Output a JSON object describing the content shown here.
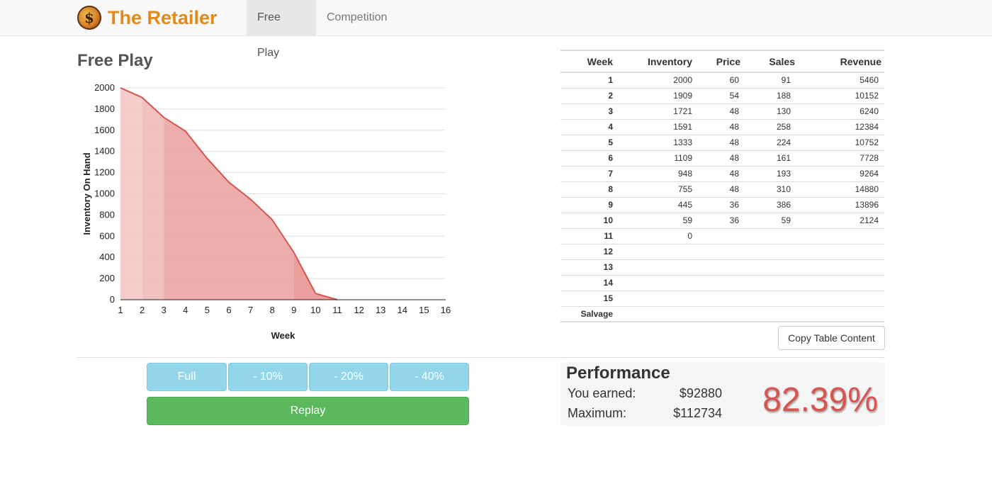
{
  "nav": {
    "brand_title": "The Retailer",
    "brand_glyph": "$",
    "tabs": [
      {
        "label": "Free Play",
        "active": true
      },
      {
        "label": "Competition",
        "active": false
      }
    ]
  },
  "page_title": "Free Play",
  "chart_data": {
    "type": "area",
    "xlabel": "Week",
    "ylabel": "Inventory On Hand",
    "x_ticks": [
      "1",
      "2",
      "3",
      "4",
      "5",
      "6",
      "7",
      "8",
      "9",
      "10",
      "11",
      "12",
      "13",
      "14",
      "15",
      "16"
    ],
    "y_ticks": [
      "0",
      "200",
      "400",
      "600",
      "800",
      "1000",
      "1200",
      "1400",
      "1600",
      "1800",
      "2000"
    ],
    "xlim": [
      1,
      16
    ],
    "ylim": [
      0,
      2000
    ],
    "grid": true,
    "series": [
      {
        "x": [
          1,
          2,
          3,
          4,
          5,
          6,
          7,
          8,
          9,
          10,
          11
        ],
        "values": [
          2000,
          1909,
          1721,
          1591,
          1333,
          1109,
          948,
          755,
          445,
          59,
          0
        ]
      }
    ],
    "price_bands": [
      {
        "from": 1,
        "to": 2,
        "price": 60
      },
      {
        "from": 2,
        "to": 3,
        "price": 54
      },
      {
        "from": 3,
        "to": 9,
        "price": 48
      },
      {
        "from": 9,
        "to": 11,
        "price": 36
      }
    ],
    "colors": {
      "line": "#d9534f",
      "fill_dark": "#e9a09e",
      "fill_light": "#f2c4c3"
    }
  },
  "table": {
    "headers": [
      "Week",
      "Inventory",
      "Price",
      "Sales",
      "Revenue"
    ],
    "rows": [
      [
        "1",
        "2000",
        "60",
        "91",
        "5460"
      ],
      [
        "2",
        "1909",
        "54",
        "188",
        "10152"
      ],
      [
        "3",
        "1721",
        "48",
        "130",
        "6240"
      ],
      [
        "4",
        "1591",
        "48",
        "258",
        "12384"
      ],
      [
        "5",
        "1333",
        "48",
        "224",
        "10752"
      ],
      [
        "6",
        "1109",
        "48",
        "161",
        "7728"
      ],
      [
        "7",
        "948",
        "48",
        "193",
        "9264"
      ],
      [
        "8",
        "755",
        "48",
        "310",
        "14880"
      ],
      [
        "9",
        "445",
        "36",
        "386",
        "13896"
      ],
      [
        "10",
        "59",
        "36",
        "59",
        "2124"
      ],
      [
        "11",
        "0",
        "",
        "",
        ""
      ],
      [
        "12",
        "",
        "",
        "",
        ""
      ],
      [
        "13",
        "",
        "",
        "",
        ""
      ],
      [
        "14",
        "",
        "",
        "",
        ""
      ],
      [
        "15",
        "",
        "",
        "",
        ""
      ],
      [
        "Salvage",
        "",
        "",
        "",
        ""
      ]
    ]
  },
  "copy_button_label": "Copy Table Content",
  "buttons": {
    "full": "Full",
    "minus10": "- 10%",
    "minus20": "- 20%",
    "minus40": "- 40%",
    "replay": "Replay"
  },
  "performance": {
    "title": "Performance",
    "earned_label": "You earned:",
    "earned_value": "$92880",
    "max_label": "Maximum:",
    "max_value": "$112734",
    "percent": "82.39%"
  },
  "colors": {
    "brand": "#e08a1e",
    "level_button": "#93d6e9",
    "replay_button": "#5cb85c",
    "percent": "#d9534f"
  }
}
